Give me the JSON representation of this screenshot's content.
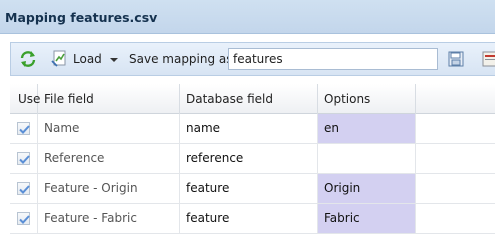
{
  "window": {
    "title": "Mapping features.csv"
  },
  "toolbar": {
    "load_label": "Load",
    "save_mapping_label": "Save mapping as",
    "mapping_name_value": "features",
    "icons": [
      "refresh-icon",
      "load-icon",
      "chevron-down-icon",
      "save-icon",
      "export-icon"
    ]
  },
  "grid": {
    "columns": [
      "Use",
      "File field",
      "Database field",
      "Options"
    ],
    "rows": [
      {
        "use": true,
        "file_field": "Name",
        "database_field": "name",
        "option": "en"
      },
      {
        "use": true,
        "file_field": "Reference",
        "database_field": "reference",
        "option": ""
      },
      {
        "use": true,
        "file_field": "Feature - Origin",
        "database_field": "feature",
        "option": "Origin"
      },
      {
        "use": true,
        "file_field": "Feature - Fabric",
        "database_field": "feature",
        "option": "Fabric"
      }
    ]
  },
  "colors": {
    "title_bar": "#c9dcef",
    "option_highlight": "#d3d0f1",
    "accent_green": "#3aa02c"
  }
}
